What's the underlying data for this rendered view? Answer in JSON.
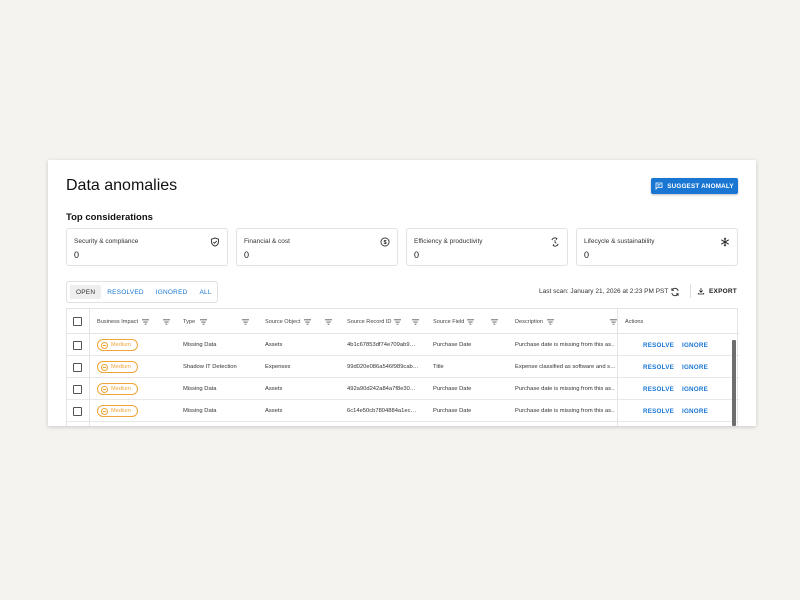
{
  "page": {
    "title": "Data anomalies",
    "suggest_button": "SUGGEST ANOMALY"
  },
  "considerations": {
    "heading": "Top considerations",
    "cards": [
      {
        "label": "Security & compliance",
        "value": "0",
        "icon": "shield-check-icon"
      },
      {
        "label": "Financial & cost",
        "value": "0",
        "icon": "dollar-circle-icon"
      },
      {
        "label": "Efficiency & productivity",
        "value": "0",
        "icon": "efficiency-icon"
      },
      {
        "label": "Lifecycle & sustainability",
        "value": "0",
        "icon": "snowflake-icon"
      }
    ]
  },
  "filters": {
    "tabs": [
      "OPEN",
      "RESOLVED",
      "IGNORED",
      "ALL"
    ],
    "active": "OPEN"
  },
  "toolbar": {
    "last_scan": "Last scan: January 21, 2026 at 2:23 PM PST",
    "export_label": "EXPORT"
  },
  "table": {
    "columns": [
      "Business Impact",
      "Type",
      "Source Object",
      "Source Record ID",
      "Source Field",
      "Description",
      "Actions"
    ],
    "rows": [
      {
        "impact": "Medium",
        "type": "Missing Data",
        "source_object": "Assets",
        "record_id": "4b1c67853df74e709ab9…",
        "field": "Purchase Date",
        "description": "Purchase date is missing from this as…",
        "resolve": "RESOLVE",
        "ignore": "IGNORE"
      },
      {
        "impact": "Medium",
        "type": "Shadow IT Detection",
        "source_object": "Expenses",
        "record_id": "99d020e086a546f989cab…",
        "field": "Title",
        "description": "Expense classified as software and s…",
        "resolve": "RESOLVE",
        "ignore": "IGNORE"
      },
      {
        "impact": "Medium",
        "type": "Missing Data",
        "source_object": "Assets",
        "record_id": "492a90d242a84a7f8e30…",
        "field": "Purchase Date",
        "description": "Purchase date is missing from this as…",
        "resolve": "RESOLVE",
        "ignore": "IGNORE"
      },
      {
        "impact": "Medium",
        "type": "Missing Data",
        "source_object": "Assets",
        "record_id": "6c14e50cb7804884a1ec…",
        "field": "Purchase Date",
        "description": "Purchase date is missing from this as…",
        "resolve": "RESOLVE",
        "ignore": "IGNORE"
      }
    ]
  },
  "colors": {
    "accent": "#1976d2",
    "impact_medium": "#f0a538",
    "background": "#f4f3ef"
  }
}
